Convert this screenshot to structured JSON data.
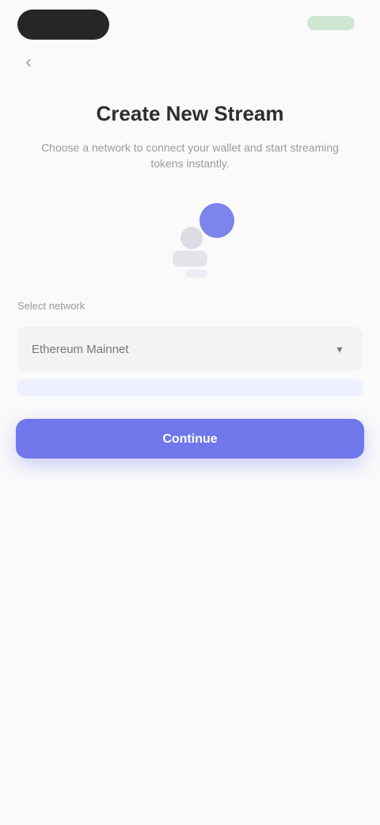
{
  "header": {
    "back_icon": "chevron-left-icon",
    "title": "Create New Stream",
    "subtitle": "Choose a network to connect your wallet and start streaming tokens instantly."
  },
  "illustration": {
    "accent_color": "#6f77ea"
  },
  "form": {
    "network_label": "Select network",
    "network_value": "Ethereum Mainnet"
  },
  "actions": {
    "continue_label": "Continue"
  },
  "colors": {
    "primary": "#6f77ea",
    "background": "#fafafa"
  }
}
